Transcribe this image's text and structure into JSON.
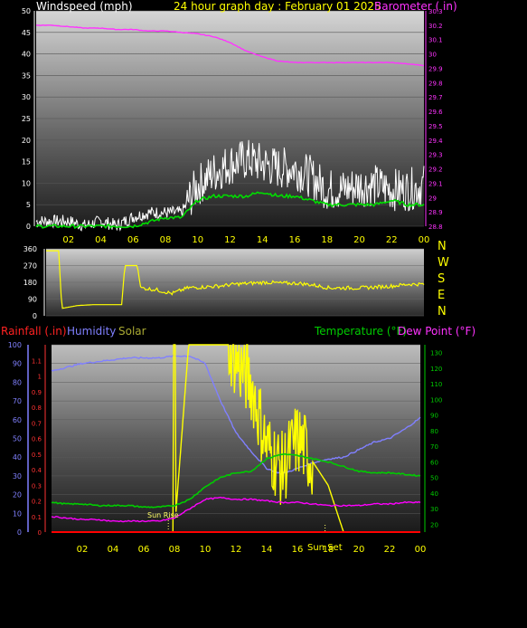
{
  "header": {
    "left_title": "Windspeed (mph)",
    "center_title": "24 hour graph day : February 01 2025",
    "right_title": "Barometer ( in)"
  },
  "colors": {
    "background": "#000000",
    "title_yellow": "#ffff00",
    "windspeed": "#ffffff",
    "wind_avg": "#00dd00",
    "barometer": "#ff33ff",
    "wind_direction": "#ffff00",
    "rainfall": "#ff0000",
    "humidity": "#8080ff",
    "solar": "#ffff00",
    "temperature": "#00cc00",
    "dew_point": "#ff00ff"
  },
  "x_ticks": [
    "02",
    "04",
    "06",
    "08",
    "10",
    "12",
    "14",
    "16",
    "18",
    "20",
    "22",
    "00"
  ],
  "mid_header": {
    "compass": [
      "N",
      "W",
      "S",
      "E",
      "N"
    ]
  },
  "bottom_header": {
    "rainfall": "Rainfall (.in)",
    "humidity": "Humidity",
    "solar": "Solar",
    "temperature": "Temperature (°F)",
    "dew_point": "Dew Point (°F)"
  },
  "annotations": {
    "sun_rise": "Sun Rise",
    "sun_set": "Sun Set"
  },
  "chart_data": [
    {
      "type": "line",
      "title": "24 hour graph day : February 01 2025",
      "x_hours": [
        0,
        1,
        2,
        3,
        4,
        5,
        6,
        7,
        8,
        9,
        10,
        11,
        12,
        13,
        14,
        15,
        16,
        17,
        18,
        19,
        20,
        21,
        22,
        23,
        24
      ],
      "y_left": {
        "label": "Windspeed (mph)",
        "ylim": [
          0,
          50
        ],
        "ticks": [
          "0",
          "5",
          "10",
          "15",
          "20",
          "25",
          "30",
          "35",
          "40",
          "45",
          "50"
        ]
      },
      "y_right": {
        "label": "Barometer ( in)",
        "ylim": [
          28.8,
          30.3
        ],
        "ticks": [
          "28.8",
          "28.9",
          "29",
          "29.1",
          "29.2",
          "29.3",
          "29.4",
          "29.5",
          "29.6",
          "29.7",
          "29.8",
          "29.9",
          "30",
          "30.1",
          "30.2",
          "30.3"
        ]
      },
      "series": [
        {
          "name": "Windspeed (mph)",
          "axis": "left",
          "values": [
            1,
            1,
            1,
            0,
            1,
            0,
            2,
            3,
            3,
            3,
            9,
            12,
            14,
            15,
            14,
            13,
            13,
            11,
            8,
            8,
            9,
            9,
            8,
            8,
            9
          ]
        },
        {
          "name": "",
          "axis": "left",
          "values": [
            0,
            0,
            0,
            0,
            0,
            0,
            0,
            1,
            2,
            2,
            6,
            7,
            7,
            7,
            8,
            7,
            7,
            6,
            5,
            5,
            5,
            5,
            6,
            5,
            5
          ]
        },
        {
          "name": "Barometer ( in)",
          "axis": "right",
          "values": [
            30.2,
            30.2,
            30.19,
            30.18,
            30.18,
            30.17,
            30.17,
            30.16,
            30.16,
            30.15,
            30.14,
            30.12,
            30.08,
            30.02,
            29.98,
            29.95,
            29.94,
            29.94,
            29.94,
            29.94,
            29.94,
            29.94,
            29.94,
            29.93,
            29.92
          ]
        }
      ]
    },
    {
      "type": "line",
      "y_left": {
        "ylim": [
          0,
          360
        ],
        "ticks": [
          "0",
          "90",
          "180",
          "270",
          "360"
        ]
      },
      "x_hours": [
        0,
        0.8,
        1,
        2,
        3,
        4,
        4.8,
        5,
        5.8,
        6,
        7,
        8,
        9,
        10,
        11,
        12,
        13,
        14,
        15,
        16,
        17,
        18,
        19,
        20,
        21,
        22,
        23,
        24
      ],
      "series": [
        {
          "name": "",
          "values": [
            350,
            350,
            40,
            55,
            60,
            60,
            60,
            270,
            270,
            150,
            140,
            120,
            150,
            155,
            160,
            170,
            175,
            180,
            175,
            175,
            165,
            150,
            150,
            150,
            155,
            160,
            170,
            170
          ]
        }
      ]
    },
    {
      "type": "line",
      "x_hours": [
        0,
        1,
        2,
        3,
        4,
        5,
        6,
        7,
        8,
        9,
        10,
        11,
        12,
        13,
        14,
        15,
        16,
        17,
        18,
        19,
        20,
        21,
        22,
        23,
        24
      ],
      "y_humidity": {
        "label": "Humidity",
        "ylim": [
          0,
          100
        ],
        "ticks": [
          "0",
          "10",
          "20",
          "30",
          "40",
          "50",
          "60",
          "70",
          "80",
          "90",
          "100"
        ]
      },
      "y_rain": {
        "label": "Rainfall (.in)",
        "ylim": [
          0,
          1.2
        ],
        "ticks": [
          "0",
          "0.1",
          "0.2",
          "0.3",
          "0.4",
          "0.5",
          "0.6",
          "0.7",
          "0.8",
          "0.9",
          "1",
          "1.1"
        ]
      },
      "y_temp": {
        "label": "Temperature (°F)",
        "ylim": [
          15,
          135
        ],
        "ticks": [
          "20",
          "30",
          "40",
          "50",
          "60",
          "70",
          "80",
          "90",
          "100",
          "110",
          "120",
          "130"
        ]
      },
      "series": [
        {
          "name": "Humidity",
          "axis": "humidity",
          "values": [
            86,
            88,
            90,
            91,
            92,
            93,
            93,
            93,
            94,
            94,
            90,
            70,
            53,
            43,
            34,
            31,
            34,
            37,
            39,
            40,
            44,
            48,
            50,
            55,
            61
          ]
        },
        {
          "name": "Solar",
          "axis": "temp",
          "values": [
            0,
            0,
            0,
            0,
            0,
            0,
            0,
            0,
            0,
            130,
            130,
            130,
            110,
            95,
            55,
            40,
            60,
            45,
            30,
            0,
            0,
            0,
            0,
            0,
            0
          ]
        },
        {
          "name": "Temperature (°F)",
          "axis": "temp",
          "values": [
            34,
            33,
            33,
            32,
            32,
            32,
            31,
            31,
            32,
            36,
            44,
            50,
            53,
            54,
            62,
            65,
            64,
            62,
            60,
            57,
            54,
            53,
            53,
            52,
            51
          ]
        },
        {
          "name": "Dew Point (°F)",
          "axis": "temp",
          "values": [
            25,
            24,
            23,
            23,
            22,
            22,
            22,
            22,
            24,
            30,
            36,
            37,
            36,
            36,
            35,
            34,
            34,
            33,
            32,
            32,
            32,
            33,
            33,
            34,
            34
          ]
        },
        {
          "name": "Rainfall (.in)",
          "axis": "rain",
          "values": [
            0,
            0,
            0,
            0,
            0,
            0,
            0,
            0,
            0,
            0,
            0,
            0,
            0,
            0,
            0,
            0,
            0,
            0,
            0,
            0,
            0,
            0,
            0,
            0,
            0
          ]
        }
      ]
    }
  ]
}
